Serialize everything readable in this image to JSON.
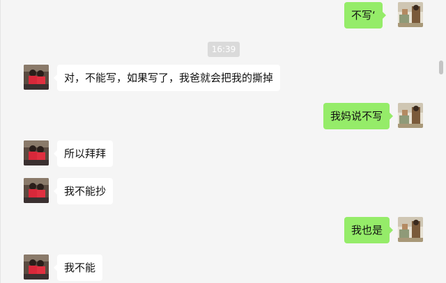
{
  "messages": [
    {
      "side": "right",
      "text": "不写‘"
    },
    {
      "side": "time",
      "text": "16:39"
    },
    {
      "side": "left",
      "text": "对，不能写，如果写了，我爸就会把我的撕掉"
    },
    {
      "side": "right",
      "text": "我妈说不写"
    },
    {
      "side": "left",
      "text": "所以拜拜"
    },
    {
      "side": "left",
      "text": "我不能抄"
    },
    {
      "side": "right",
      "text": "我也是"
    },
    {
      "side": "left",
      "text": "我不能"
    }
  ],
  "colors": {
    "background": "#f5f5f5",
    "outgoing_bubble": "#95ec69",
    "incoming_bubble": "#ffffff",
    "timestamp_badge": "#dadada"
  },
  "icons": {
    "self_avatar": "self-avatar-icon",
    "contact_avatar": "contact-avatar-icon"
  }
}
